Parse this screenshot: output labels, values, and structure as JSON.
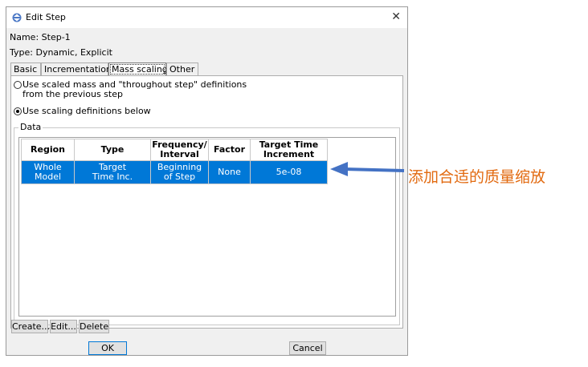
{
  "dialog": {
    "title": "Edit Step",
    "name_line": "Name: Step-1",
    "type_line": "Type: Dynamic, Explicit"
  },
  "tabs": [
    {
      "label": "Basic"
    },
    {
      "label": "Incrementation"
    },
    {
      "label": "Mass scaling",
      "active": true
    },
    {
      "label": "Other"
    }
  ],
  "options": {
    "previous": "Use scaled mass and \"throughout step\" definitions",
    "previous_cont": "from the previous step",
    "below": "Use scaling definitions below",
    "selected": "below"
  },
  "data_group": {
    "title": "Data",
    "columns": [
      {
        "line1": "Region",
        "line2": ""
      },
      {
        "line1": "Type",
        "line2": ""
      },
      {
        "line1": "Frequency/",
        "line2": "Interval"
      },
      {
        "line1": "Factor",
        "line2": ""
      },
      {
        "line1": "Target Time",
        "line2": "Increment"
      }
    ],
    "rows": [
      [
        {
          "line1": "Whole",
          "line2": "Model"
        },
        {
          "line1": "Target",
          "line2": "Time Inc."
        },
        {
          "line1": "Beginning",
          "line2": "of Step"
        },
        {
          "line1": "None",
          "line2": ""
        },
        {
          "line1": "5e-08",
          "line2": ""
        }
      ]
    ]
  },
  "buttons": {
    "create": "Create...",
    "edit": "Edit...",
    "delete": "Delete",
    "ok": "OK",
    "cancel": "Cancel"
  },
  "annotation": {
    "text": "添加合适的质量缩放",
    "arrow_color": "#4472c4",
    "text_color": "#e26a10"
  },
  "colors": {
    "selection": "#0078d7",
    "dialog_bg": "#f0f0f0"
  }
}
